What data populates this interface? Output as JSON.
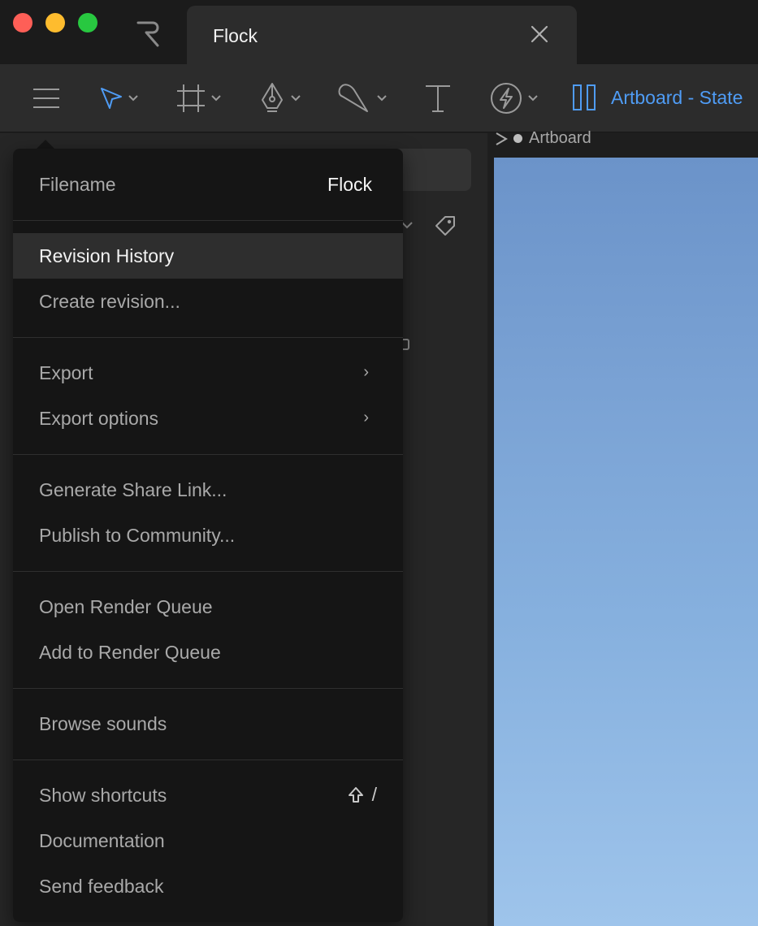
{
  "window": {
    "tab_title": "Flock"
  },
  "toolbar": {
    "artboard_label": "Artboard - State"
  },
  "canvas": {
    "artboard_caption": "Artboard"
  },
  "menu": {
    "filename_label": "Filename",
    "filename_value": "Flock",
    "revision_history": "Revision History",
    "create_revision": "Create revision...",
    "export": "Export",
    "export_options": "Export options",
    "generate_share_link": "Generate Share Link...",
    "publish_to_community": "Publish to Community...",
    "open_render_queue": "Open Render Queue",
    "add_to_render_queue": "Add to Render Queue",
    "browse_sounds": "Browse sounds",
    "show_shortcuts": "Show shortcuts",
    "show_shortcuts_key": "/",
    "documentation": "Documentation",
    "send_feedback": "Send feedback",
    "submenu_arrow": "›"
  },
  "colors": {
    "accent": "#4f9cf5",
    "menu_bg": "#151515",
    "menu_active": "#2e2e2e"
  }
}
